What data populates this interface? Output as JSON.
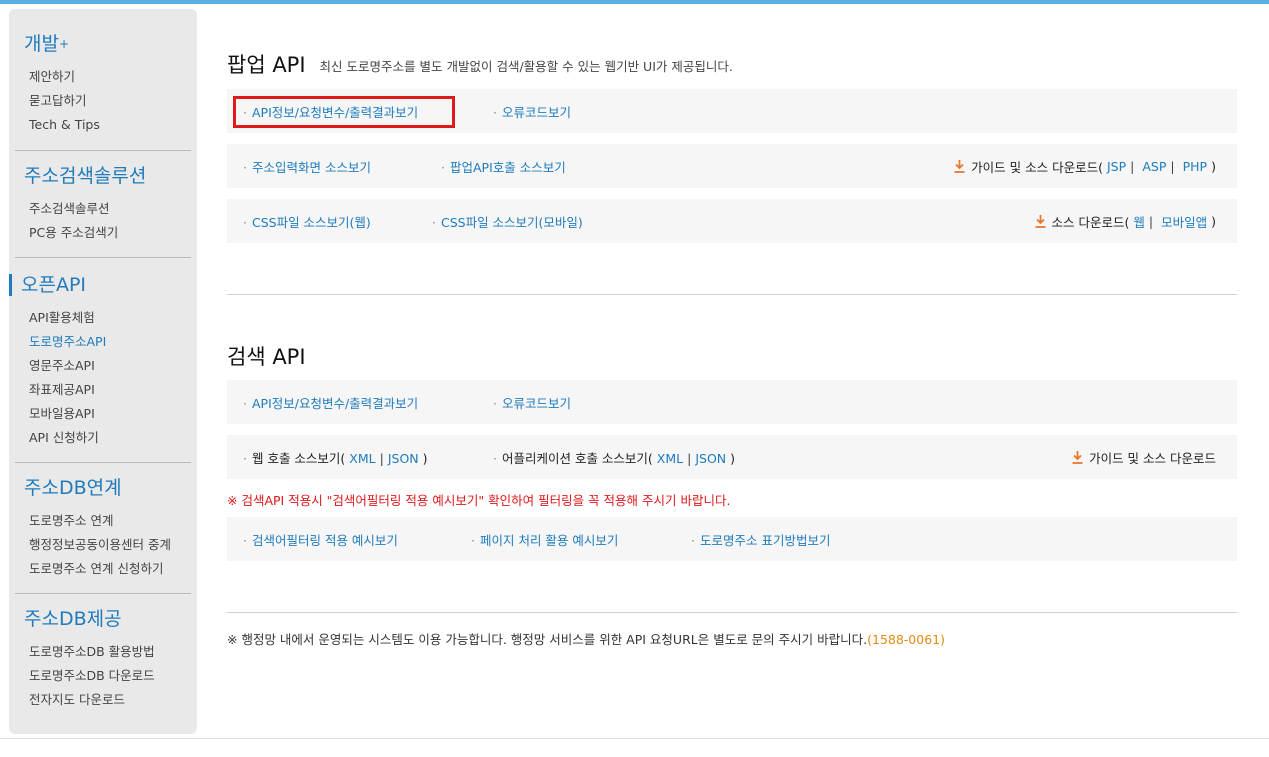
{
  "sidebar": {
    "groups": [
      {
        "title": "개발",
        "title_mark": "+",
        "items": [
          "제안하기",
          "묻고답하기",
          "Tech & Tips"
        ]
      },
      {
        "title": "주소검색솔루션",
        "items": [
          "주소검색솔루션",
          "PC용 주소검색기"
        ]
      },
      {
        "title": "오픈API",
        "items": [
          "API활용체험",
          "도로명주소API",
          "영문주소API",
          "좌표제공API",
          "모바일용API",
          "API 신청하기"
        ]
      },
      {
        "title": "주소DB연계",
        "items": [
          "도로명주소 연계",
          "행정정보공동이용센터 중계",
          "도로명주소 연계 신청하기"
        ]
      },
      {
        "title": "주소DB제공",
        "items": [
          "도로명주소DB 활용방법",
          "도로명주소DB 다운로드",
          "전자지도 다운로드"
        ]
      }
    ]
  },
  "popup": {
    "title": "팝업 API",
    "desc": "최신 도로명주소를 별도 개발없이 검색/활용할 수 있는 웹기반 UI가 제공됩니다.",
    "row1": {
      "link1": "API정보/요청변수/출력결과보기",
      "link2": "오류코드보기"
    },
    "row2": {
      "link1": "주소입력화면 소스보기",
      "link2": "팝업API호출 소스보기",
      "right_prefix": "가이드 및 소스 다운로드(",
      "jsp": "JSP",
      "asp": "ASP",
      "php": "PHP",
      "right_suffix": ")"
    },
    "row3": {
      "link1": "CSS파일 소스보기(웹)",
      "link2": "CSS파일 소스보기(모바일)",
      "right_prefix": "소스 다운로드(",
      "web": "웹",
      "mobile": "모바일앱",
      "right_suffix": ")"
    }
  },
  "search": {
    "title": "검색 API",
    "row1": {
      "link1": "API정보/요청변수/출력결과보기",
      "link2": "오류코드보기"
    },
    "row2": {
      "web_prefix": "웹 호출 소스보기(",
      "web_xml": "XML",
      "web_json": "JSON",
      "app_prefix": "어플리케이션 호출 소스보기(",
      "app_xml": "XML",
      "app_json": "JSON",
      "suffix": ")",
      "right": "가이드 및 소스 다운로드"
    },
    "warning": "※ 검색API 적용시 \"검색어필터링 적용 예시보기\" 확인하여 필터링을 꼭 적용해 주시기 바랍니다.",
    "row3": {
      "link1": "검색어필터링 적용 예시보기",
      "link2": "페이지 처리 활용 예시보기",
      "link3": "도로명주소 표기방법보기"
    }
  },
  "note": {
    "text": "※ 행정망 내에서 운영되는 시스템도 이용 가능합니다. 행정망 서비스를 위한 API 요청URL은 별도로 문의 주시기 바랍니다.",
    "phone": "(1588-0061)"
  },
  "colors": {
    "accent": "#1f7bbd",
    "warning": "#e0171b",
    "download_icon": "#e8772e",
    "phone": "#e08a1a"
  }
}
